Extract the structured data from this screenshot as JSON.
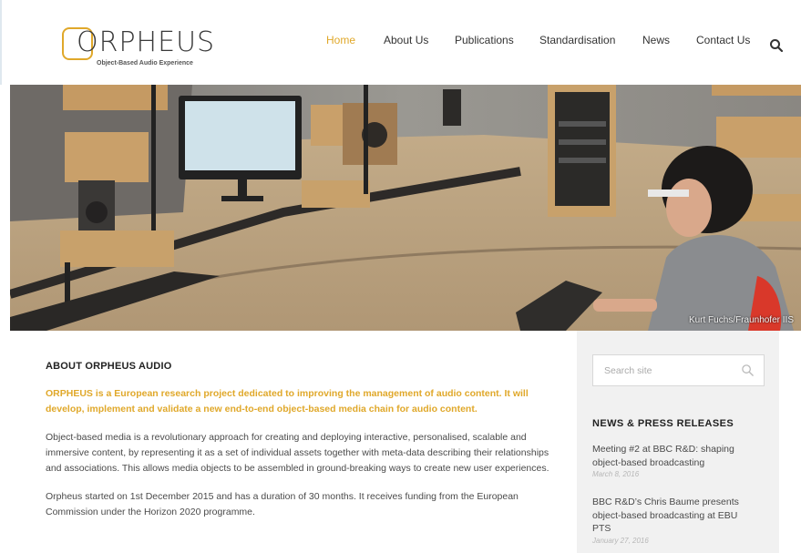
{
  "brand": {
    "name": "ORPHEUS",
    "tagline": "Object-Based Audio Experience",
    "accent_color": "#e0a82a"
  },
  "nav": {
    "items": [
      {
        "label": "Home",
        "active": true
      },
      {
        "label": "About Us",
        "active": false
      },
      {
        "label": "Publications",
        "active": false
      },
      {
        "label": "Standardisation",
        "active": false
      },
      {
        "label": "News",
        "active": false
      },
      {
        "label": "Contact Us",
        "active": false
      }
    ],
    "search_icon": "search-icon"
  },
  "hero": {
    "credit": "Kurt Fuchs/Fraunhofer IIS"
  },
  "about": {
    "title": "ABOUT ORPHEUS AUDIO",
    "lead": "ORPHEUS is a European research project dedicated to improving the management of audio content. It will develop, implement and validate a new end-to-end object-based media chain for audio content.",
    "paragraphs": [
      "Object-based media is a revolutionary approach for creating and deploying interactive, personalised, scalable and immersive content, by representing it as a set of individual assets together with meta-data describing their relationships and associations. This allows media objects to be assembled in ground-breaking ways to create new user experiences.",
      "Orpheus started on 1st December 2015 and has a duration of 30 months. It receives funding from the European Commission under the Horizon 2020 programme."
    ]
  },
  "sidebar": {
    "search_placeholder": "Search site",
    "news_title": "NEWS & PRESS RELEASES",
    "news": [
      {
        "title": "Meeting #2 at BBC R&D: shaping object-based broadcasting",
        "date": "March 8, 2016"
      },
      {
        "title": "BBC R&D’s Chris Baume presents object-based broadcasting at EBU PTS",
        "date": "January 27, 2016"
      }
    ]
  }
}
